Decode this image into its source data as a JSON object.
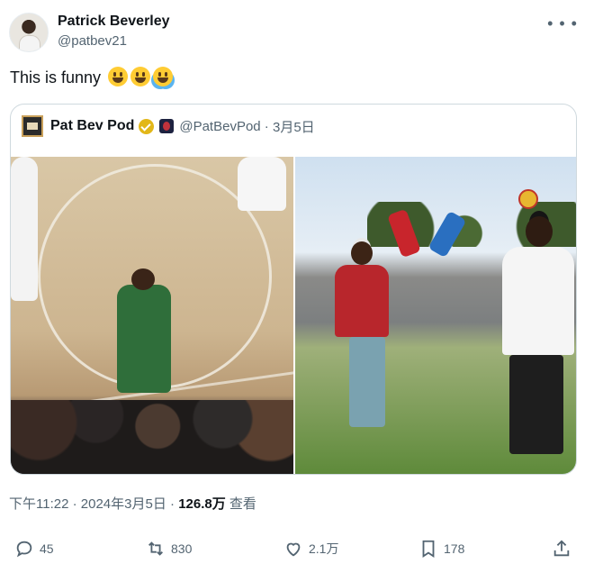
{
  "user": {
    "name": "Patrick Beverley",
    "handle": "@patbev21",
    "avatar_icon": "user-avatar"
  },
  "more_icon": "more-options-icon",
  "tweet": {
    "text": "This is funny"
  },
  "emojis": [
    "smiley-emoji",
    "grin-emoji",
    "tears-of-joy-emoji"
  ],
  "quote": {
    "name": "Pat Bev Pod",
    "handle": "@PatBevPod",
    "date": "3月5日",
    "verified_color": "#e2b719"
  },
  "meta": {
    "time": "下午11:22",
    "date": "2024年3月5日",
    "views": "126.8万",
    "views_label": "查看"
  },
  "actions": {
    "reply": "45",
    "retweet": "830",
    "like": "2.1万",
    "bookmark": "178"
  },
  "colors": {
    "text": "#0f1419",
    "secondary": "#536471",
    "border": "#cfd9de"
  }
}
